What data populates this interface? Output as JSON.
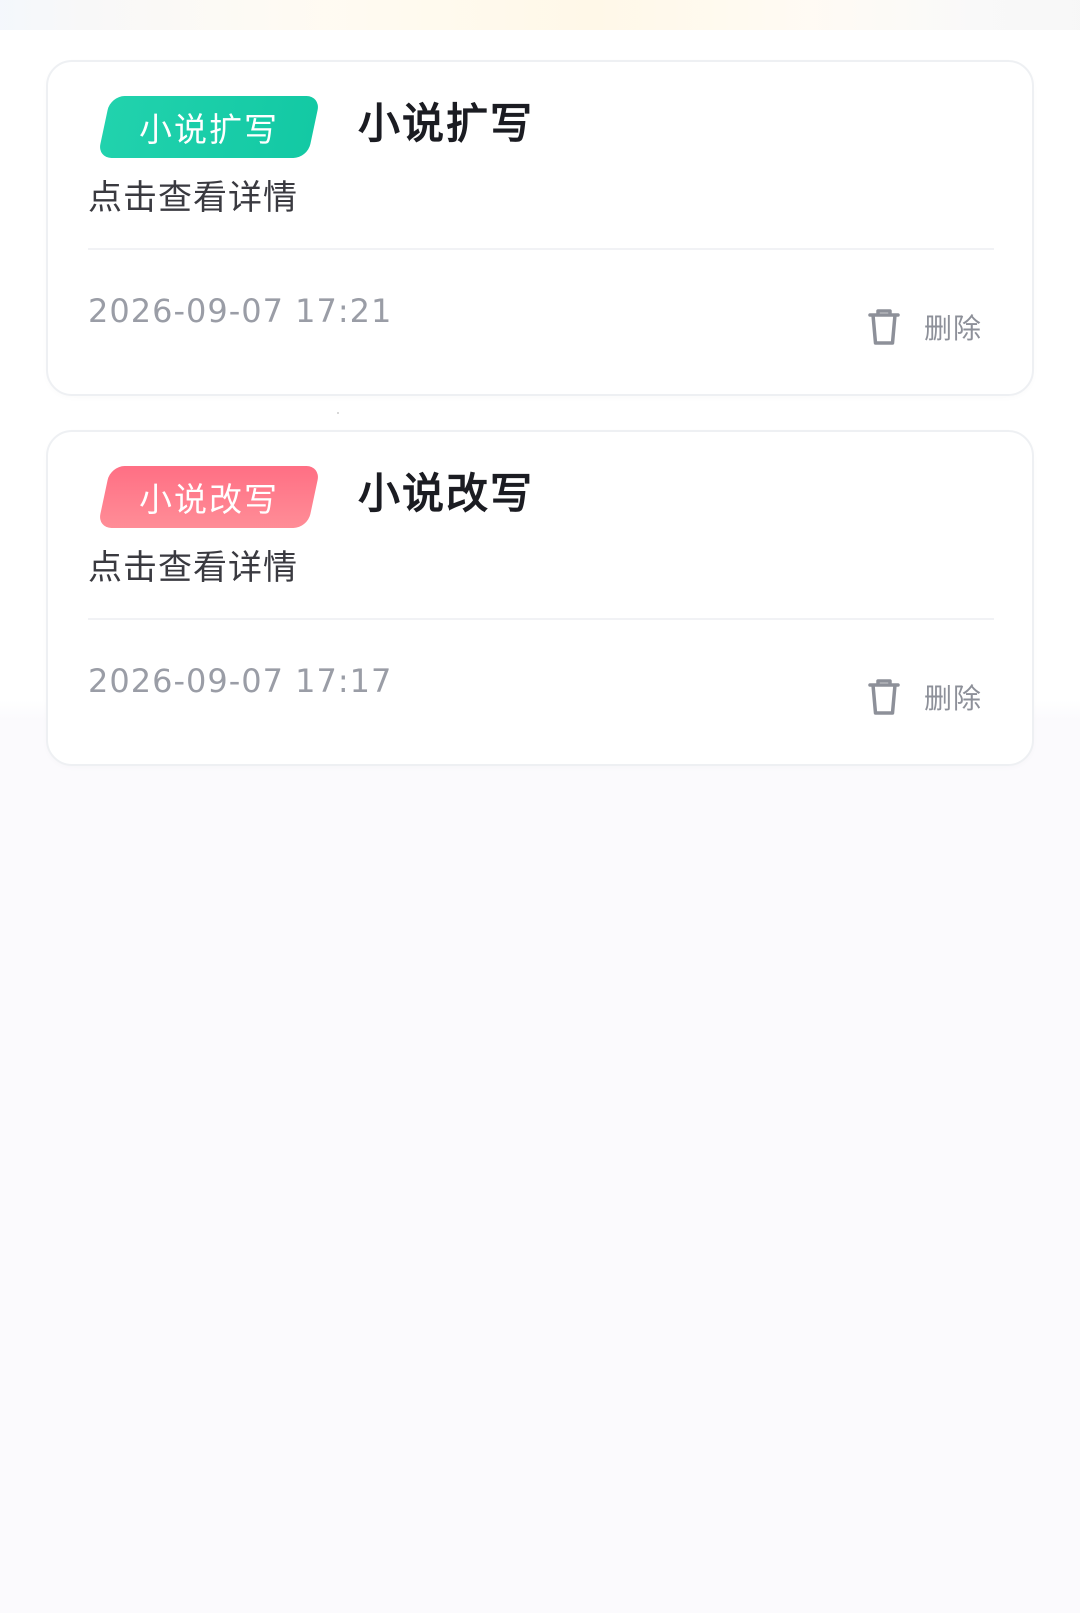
{
  "colors": {
    "tag_expand": "#16cba6",
    "tag_rewrite": "#ff7b8a",
    "title": "#1b1c22",
    "subtitle": "#3a3a40",
    "time": "#9a9da6",
    "delete": "#8d9099"
  },
  "records": [
    {
      "tag": "小说扩写",
      "title": "小说扩写",
      "subtitle": "点击查看详情",
      "time": "2026-09-07 17:21",
      "delete_icon": "trash-icon",
      "delete_label": "删除"
    },
    {
      "tag": "小说改写",
      "title": "小说改写",
      "subtitle": "点击查看详情",
      "time": "2026-09-07 17:17",
      "delete_icon": "trash-icon",
      "delete_label": "删除"
    }
  ]
}
